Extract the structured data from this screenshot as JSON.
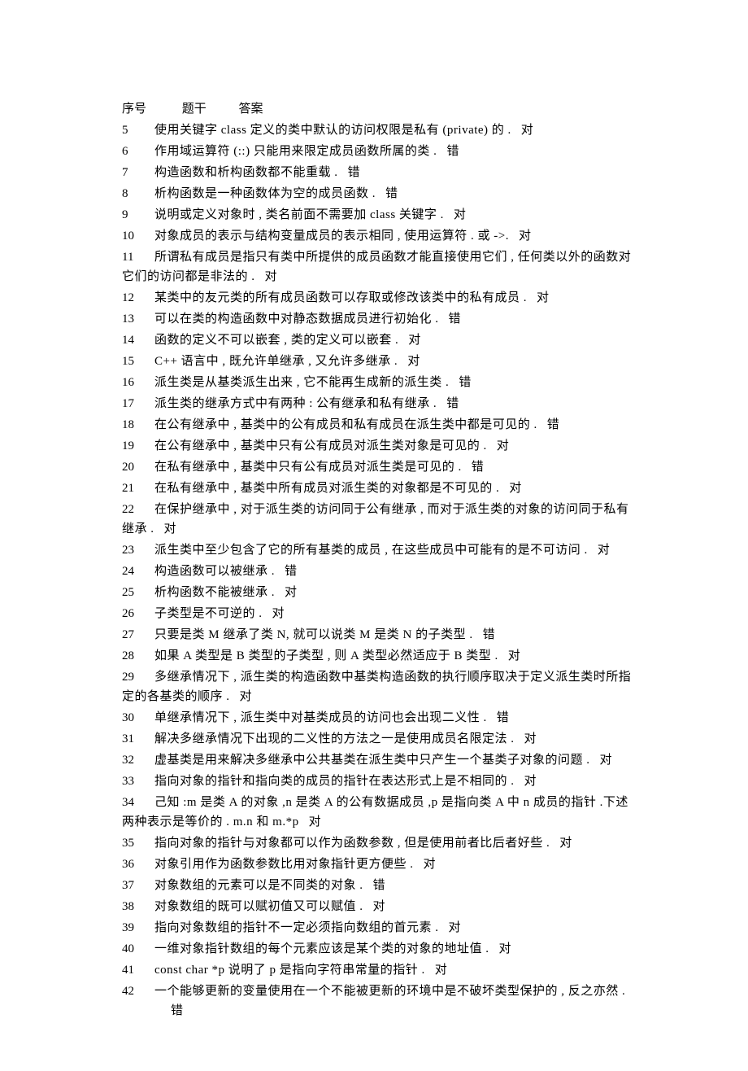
{
  "header": {
    "col_num": "序号",
    "col_q": "题干",
    "col_a": "答案"
  },
  "rows": [
    {
      "num": "5",
      "q": "使用关键字  class 定义的类中默认的访问权限是私有   (private) 的 .",
      "a": "对"
    },
    {
      "num": "6",
      "q": "作用域运算符  (::) 只能用来限定成员函数所属的类   .",
      "a": "错"
    },
    {
      "num": "7",
      "q": "构造函数和析构函数都不能重载   .",
      "a": "错"
    },
    {
      "num": "8",
      "q": "析构函数是一种函数体为空的成员函数   .",
      "a": "错"
    },
    {
      "num": "9",
      "q": "说明或定义对象时  , 类名前面不需要加   class 关键字 .",
      "a": "对"
    },
    {
      "num": "10",
      "q": "对象成员的表示与结构变量成员的表示相同    , 使用运算符 . 或 ->.",
      "a": "对"
    },
    {
      "num": "11",
      "q": "所谓私有成员是指只有类中所提供的成员函数才能直接使用它们    , 任何类以外的函数对它们的访问都是非法的   .",
      "a": "对"
    },
    {
      "num": "12",
      "q": "某类中的友元类的所有成员函数可以存取或修改该类中的私有成员    .",
      "a": "对"
    },
    {
      "num": "13",
      "q": "可以在类的构造函数中对静态数据成员进行初始化    .",
      "a": "错"
    },
    {
      "num": "14",
      "q": "函数的定义不可以嵌套   , 类的定义可以嵌套   .",
      "a": "对"
    },
    {
      "num": "15",
      "q": "C++ 语言中 , 既允许单继承 , 又允许多继承 .",
      "a": "对"
    },
    {
      "num": "16",
      "q": "派生类是从基类派生出来  , 它不能再生成新的派生类   .",
      "a": "错"
    },
    {
      "num": "17",
      "q": "派生类的继承方式中有两种   : 公有继承和私有继承   .",
      "a": "错"
    },
    {
      "num": "18",
      "q": "在公有继承中  , 基类中的公有成员和私有成员在派生类中都是可见的    .",
      "a": "错"
    },
    {
      "num": "19",
      "q": "在公有继承中  , 基类中只有公有成员对派生类对象是可见的    .",
      "a": "对"
    },
    {
      "num": "20",
      "q": "在私有继承中  , 基类中只有公有成员对派生类是可见的   .",
      "a": "错"
    },
    {
      "num": "21",
      "q": "在私有继承中  , 基类中所有成员对派生类的对象都是不可见的    .",
      "a": "对"
    },
    {
      "num": "22",
      "q": "在保护继承中  , 对于派生类的访问同于公有继承   , 而对于派生类的对象的访问同于私有继承 .",
      "a": "对"
    },
    {
      "num": "23",
      "q": "派生类中至少包含了它的所有基类的成员    , 在这些成员中可能有的是不可访问   .",
      "a": "对"
    },
    {
      "num": "24",
      "q": "构造函数可以被继承   .",
      "a": "错"
    },
    {
      "num": "25",
      "q": "析构函数不能被继承   .",
      "a": "对"
    },
    {
      "num": "26",
      "q": "子类型是不可逆的   .",
      "a": "对"
    },
    {
      "num": "27",
      "q": "只要是类  M 继承了类  N, 就可以说类  M 是类  N 的子类型 .",
      "a": "错"
    },
    {
      "num": "28",
      "q": "如果 A 类型是  B 类型的子类型 , 则 A 类型必然适应于   B 类型 .",
      "a": "对"
    },
    {
      "num": "29",
      "q": "多继承情况下  , 派生类的构造函数中基类构造函数的执行顺序取决于定义派生类时所指定的各基类的顺序   .",
      "a": "对"
    },
    {
      "num": "30",
      "q": "单继承情况下  , 派生类中对基类成员的访问也会出现二义性    .",
      "a": "错"
    },
    {
      "num": "31",
      "q": "解决多继承情况下出现的二义性的方法之一是使用成员名限定法    .",
      "a": "对"
    },
    {
      "num": "32",
      "q": "虚基类是用来解决多继承中公共基类在派生类中只产生一个基类子对象的问题     .",
      "a": "对"
    },
    {
      "num": "33",
      "q": "指向对象的指针和指向类的成员的指针在表达形式上是不相同的    .",
      "a": "对"
    },
    {
      "num": "34",
      "q": "己知 :m 是类  A 的对象 ,n 是类  A 的公有数据成员  ,p 是指向类  A 中 n 成员的指针 .下述两种表示是等价的  . m.n 和 m.*p",
      "a": "对"
    },
    {
      "num": "35",
      "q": "指向对象的指针与对象都可以作为函数参数    , 但是使用前者比后者好些   .",
      "a": "对"
    },
    {
      "num": "36",
      "q": "对象引用作为函数参数比用对象指针更方便些    .",
      "a": "对"
    },
    {
      "num": "37",
      "q": "对象数组的元素可以是不同类的对象   .",
      "a": "错"
    },
    {
      "num": "38",
      "q": "对象数组的既可以赋初值又可以赋值    .",
      "a": "对"
    },
    {
      "num": "39",
      "q": "指向对象数组的指针不一定必须指向数组的首元素    .",
      "a": "对"
    },
    {
      "num": "40",
      "q": "一维对象指针数组的每个元素应该是某个类的对象的地址值    .",
      "a": "对"
    },
    {
      "num": "41",
      "q": "const char *p 说明了  p 是指向字符串常量的指针   .",
      "a": "对"
    },
    {
      "num": "42",
      "q": "一个能够更新的变量使用在一个不能被更新的环境中是不破坏类型保护的     , 反之亦然 .",
      "a": "错",
      "indent_answer": true
    }
  ]
}
